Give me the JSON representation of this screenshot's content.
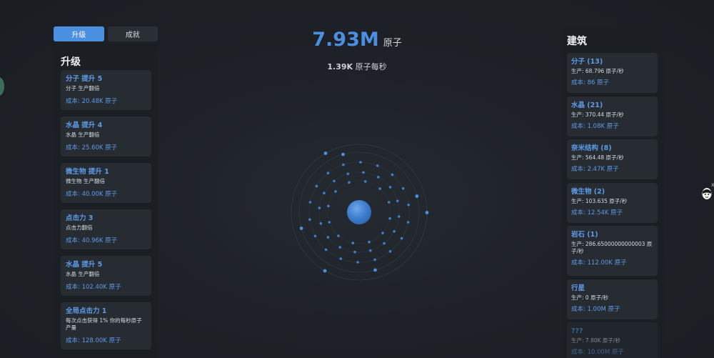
{
  "tabs": {
    "upgrades_label": "升级",
    "achievements_label": "成就"
  },
  "upgrades_panel": {
    "title": "升级",
    "items": [
      {
        "title": "分子 提升 5",
        "desc": "分子 生产翻倍",
        "cost": "成本: 20.48K 原子"
      },
      {
        "title": "水晶 提升 4",
        "desc": "水晶 生产翻倍",
        "cost": "成本: 25.60K 原子"
      },
      {
        "title": "微生物 提升 1",
        "desc": "微生物 生产翻倍",
        "cost": "成本: 40.00K 原子"
      },
      {
        "title": "点击力 3",
        "desc": "点击力翻倍",
        "cost": "成本: 40.96K 原子"
      },
      {
        "title": "水晶 提升 5",
        "desc": "水晶 生产翻倍",
        "cost": "成本: 102.40K 原子"
      },
      {
        "title": "全局点击力 1",
        "desc": "每次点击获得 1% 你的每秒原子产量",
        "cost": "成本: 128.00K 原子"
      }
    ]
  },
  "counter": {
    "value": "7.93M",
    "unit": "原子"
  },
  "rate": {
    "value": "1.39K",
    "unit": "原子每秒"
  },
  "buildings_panel": {
    "title": "建筑",
    "items": [
      {
        "title": "分子 (13)",
        "prod": "生产: 68.796 原子/秒",
        "cost": "成本: 86 原子"
      },
      {
        "title": "水晶 (21)",
        "prod": "生产: 370.44 原子/秒",
        "cost": "成本: 1.08K 原子"
      },
      {
        "title": "奈米结构 (8)",
        "prod": "生产: 564.48 原子/秒",
        "cost": "成本: 2.47K 原子"
      },
      {
        "title": "微生物 (2)",
        "prod": "生产: 103.635 原子/秒",
        "cost": "成本: 12.54K 原子"
      },
      {
        "title": "岩石 (1)",
        "prod": "生产: 286.65000000000003 原子/秒",
        "cost": "成本: 112.00K 原子"
      },
      {
        "title": "行星",
        "prod": "生产: 0 原子/秒",
        "cost": "成本: 1.00M 原子"
      },
      {
        "title": "???",
        "prod": "生产: 7.80K 原子/秒",
        "cost": "成本: 10.00M 原子"
      }
    ]
  },
  "misc": {
    "close_symbol": "x"
  },
  "colors": {
    "accent": "#4a8fe0",
    "card_bg": "#272c33",
    "panel_bg": "#1b1f24"
  },
  "icons": {
    "atom": "atom-nucleus-icon",
    "mascot": "mascot-icon",
    "orb": "orb-icon"
  }
}
